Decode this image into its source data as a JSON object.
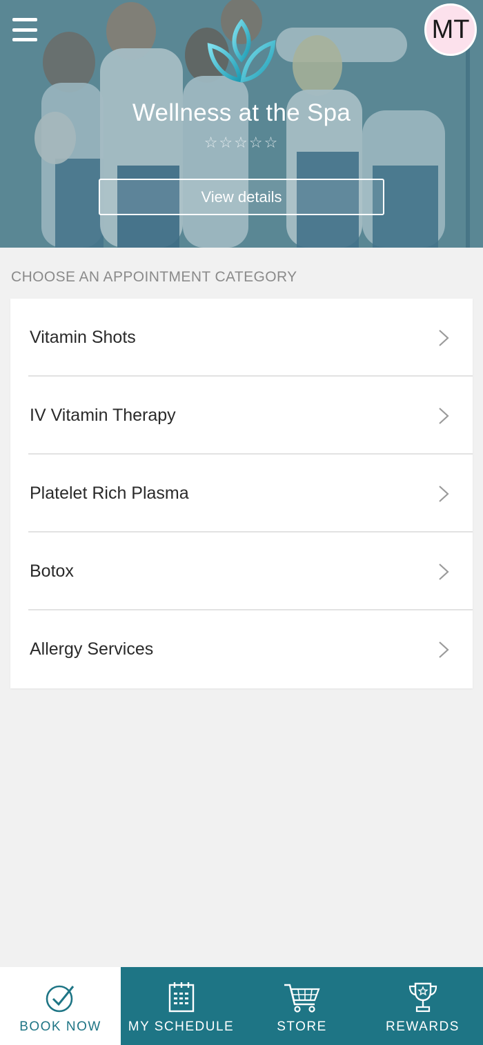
{
  "header": {
    "avatar_initials": "MT",
    "title": "Wellness at the Spa",
    "stars": "☆☆☆☆☆",
    "view_details_label": "View details"
  },
  "categories": {
    "section_label": "CHOOSE AN APPOINTMENT CATEGORY",
    "items": [
      {
        "label": "Vitamin Shots"
      },
      {
        "label": "IV Vitamin Therapy"
      },
      {
        "label": "Platelet Rich Plasma"
      },
      {
        "label": "Botox"
      },
      {
        "label": "Allergy Services"
      }
    ]
  },
  "bottom_nav": {
    "items": [
      {
        "label": "BOOK NOW",
        "icon": "check-circle-icon",
        "active": true
      },
      {
        "label": "MY SCHEDULE",
        "icon": "calendar-icon",
        "active": false
      },
      {
        "label": "STORE",
        "icon": "cart-icon",
        "active": false
      },
      {
        "label": "REWARDS",
        "icon": "trophy-icon",
        "active": false
      }
    ]
  },
  "colors": {
    "brand": "#1e7585",
    "background": "#f1f1f1",
    "avatar_bg": "#fce1ec"
  }
}
